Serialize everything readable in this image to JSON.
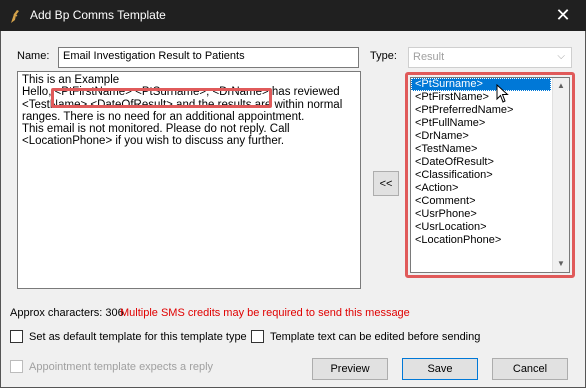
{
  "window": {
    "title": "Add Bp Comms Template",
    "close_glyph": "✕"
  },
  "form": {
    "name_label": "Name:",
    "name_value": "Email Investigation Result to Patients",
    "type_label": "Type:",
    "type_value": "Result"
  },
  "template_lines": [
    "This is an Example",
    "Hello, <PtFirstName> <PtSurname>, <DrName> has reviewed",
    "<TestName> <DateOfResult> and the results are within normal",
    "ranges. There is no need for an additional appointment.",
    "This email is not monitored. Please do not reply. Call",
    "<LocationPhone> if you wish to discuss any further."
  ],
  "insert_button_label": "<<",
  "field_list": {
    "selected_index": 0,
    "items": [
      "<PtSurname>",
      "<PtFirstName>",
      "<PtPreferredName>",
      "<PtFullName>",
      "<DrName>",
      "<TestName>",
      "<DateOfResult>",
      "<Classification>",
      "<Action>",
      "<Comment>",
      "<UsrPhone>",
      "<UsrLocation>",
      "<LocationPhone>"
    ]
  },
  "status": {
    "approx_characters": "Approx characters: 306",
    "sms_warning": "Multiple SMS credits may be required to send this message",
    "warning_color": "#e00000"
  },
  "options": {
    "default_template": "Set as default template for this template type",
    "editable_before_send": "Template text can be edited before sending",
    "expects_reply": "Appointment template expects a reply"
  },
  "buttons": {
    "preview": "Preview",
    "save": "Save",
    "cancel": "Cancel"
  },
  "colors": {
    "titlebar": "#202020",
    "highlight_box": "#e05a5a",
    "selection": "#0078d7"
  }
}
